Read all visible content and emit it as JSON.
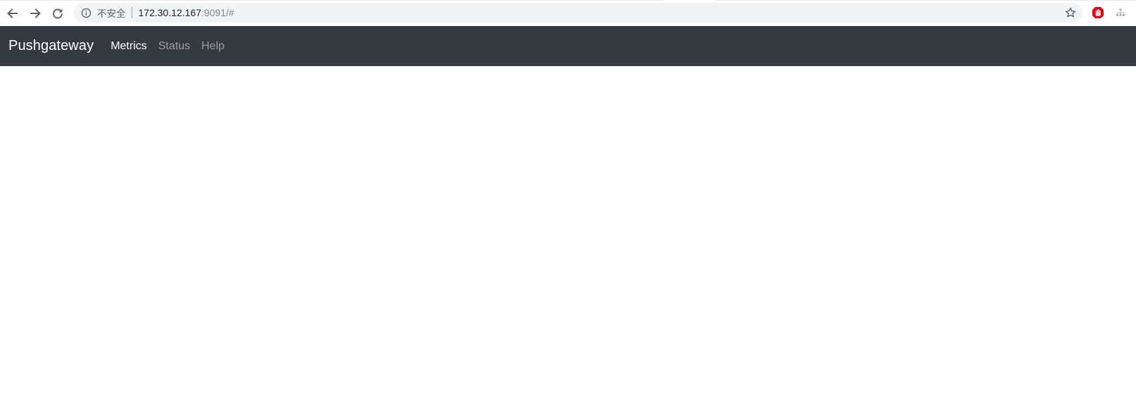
{
  "browser": {
    "security_label": "不安全",
    "url_host": "172.30.12.167",
    "url_rest": ":9091/#",
    "icons": {
      "back": "arrow-left",
      "forward": "arrow-right",
      "reload": "reload",
      "info": "info-circle",
      "bookmark": "star-outline",
      "extension_1": "red-shield-hand",
      "extension_2": "network-tree"
    }
  },
  "navbar": {
    "brand": "Pushgateway",
    "links": [
      {
        "label": "Metrics",
        "active": true
      },
      {
        "label": "Status",
        "active": false
      },
      {
        "label": "Help",
        "active": false
      }
    ]
  },
  "colors": {
    "navbar_bg": "#343a40",
    "omnibox_bg": "#f1f3f4",
    "extension_red": "#e0001b"
  }
}
